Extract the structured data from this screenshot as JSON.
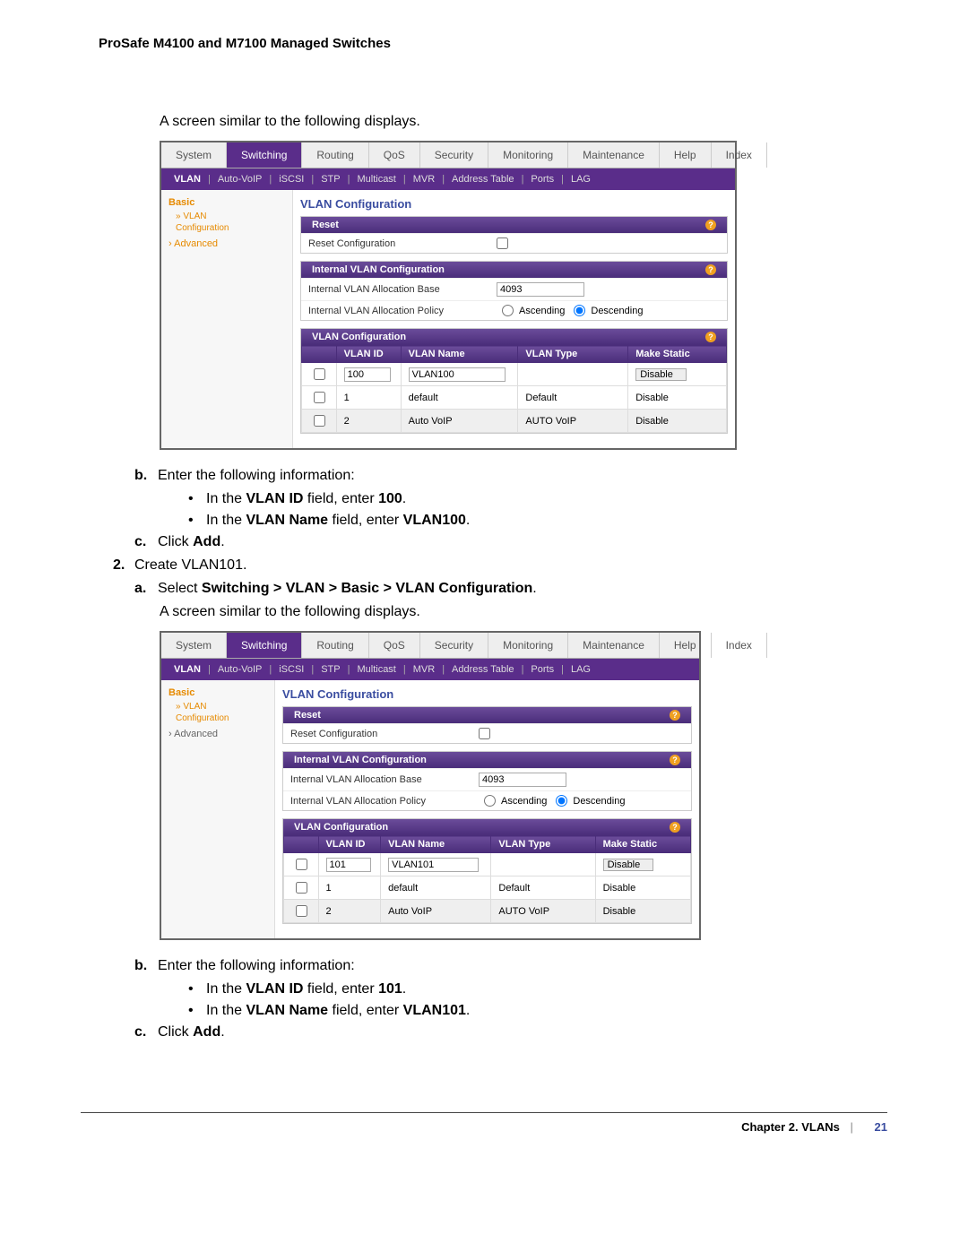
{
  "doc_title": "ProSafe M4100 and M7100 Managed Switches",
  "intro1": "A screen similar to the following displays.",
  "main_tabs": [
    "System",
    "Switching",
    "Routing",
    "QoS",
    "Security",
    "Monitoring",
    "Maintenance",
    "Help",
    "Index"
  ],
  "main_tabs_active": "Switching",
  "sub_tabs": [
    "VLAN",
    "Auto-VoIP",
    "iSCSI",
    "STP",
    "Multicast",
    "MVR",
    "Address Table",
    "Ports",
    "LAG"
  ],
  "sub_tabs_active": "VLAN",
  "side": {
    "basic": "Basic",
    "vlan": "VLAN",
    "conf": "Configuration",
    "advanced": "Advanced"
  },
  "panel": {
    "heading": "VLAN Configuration",
    "reset_hdr": "Reset",
    "reset_label": "Reset Configuration",
    "ivc_hdr": "Internal VLAN Configuration",
    "ivc_base_label": "Internal VLAN Allocation Base",
    "ivc_base_val": "4093",
    "ivc_policy_label": "Internal VLAN Allocation Policy",
    "ivc_asc": "Ascending",
    "ivc_desc": "Descending",
    "vlan_conf_hdr": "VLAN Configuration",
    "cols": {
      "id": "VLAN ID",
      "name": "VLAN Name",
      "type": "VLAN Type",
      "static": "Make Static"
    },
    "disable_sel": "Disable"
  },
  "screenshot1_rows": {
    "input": {
      "id": "100",
      "name": "VLAN100"
    },
    "r1": {
      "id": "1",
      "name": "default",
      "type": "Default",
      "static": "Disable"
    },
    "r2": {
      "id": "2",
      "name": "Auto VoIP",
      "type": "AUTO VoIP",
      "static": "Disable"
    }
  },
  "step_b": "Enter the following information:",
  "bullets1": {
    "pre1": "In the ",
    "bold1": "VLAN ID",
    "mid1": " field, enter ",
    "val1": "100",
    "post1": ".",
    "pre2": "In the ",
    "bold2": "VLAN Name",
    "mid2": " field, enter ",
    "val2": "VLAN100",
    "post2": "."
  },
  "step_c_pre": "Click ",
  "step_c_bold": "Add",
  "step_c_post": ".",
  "step2": "Create VLAN101.",
  "step_a_pre": "Select ",
  "step_a_bold": "Switching > VLAN > Basic > VLAN Configuration",
  "step_a_post": ".",
  "intro2": "A screen similar to the following displays.",
  "screenshot2_rows": {
    "input": {
      "id": "101",
      "name": "VLAN101"
    },
    "r1": {
      "id": "1",
      "name": "default",
      "type": "Default",
      "static": "Disable"
    },
    "r2": {
      "id": "2",
      "name": "Auto VoIP",
      "type": "AUTO VoIP",
      "static": "Disable"
    }
  },
  "bullets2": {
    "pre1": "In the ",
    "bold1": "VLAN ID",
    "mid1": " field, enter ",
    "val1": "101",
    "post1": ".",
    "pre2": "In the ",
    "bold2": "VLAN Name",
    "mid2": " field, enter ",
    "val2": "VLAN101",
    "post2": "."
  },
  "footer": {
    "chapter": "Chapter 2.  VLANs",
    "page": "21"
  }
}
